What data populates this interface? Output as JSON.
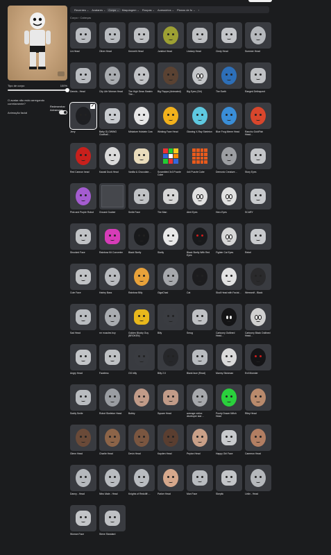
{
  "left_panel": {
    "body_type_label": "Tipo de corpo",
    "body_type_value": "100%",
    "body_type_level": 1.0,
    "warning_text": "O avatar não está carregando corretamente?",
    "redraw_label": "Redesenhar Advanced",
    "animation_label": "Animação facial",
    "animation_on": true
  },
  "tabs": [
    {
      "label": "Recentes"
    },
    {
      "label": "Avatares"
    },
    {
      "label": "Corpo",
      "selected": true
    },
    {
      "label": "Maquiagem"
    },
    {
      "label": "Roupas"
    },
    {
      "label": "Acessórios"
    },
    {
      "label": "Planos de fu"
    }
  ],
  "breadcrumb": "Corpo › Cabeças",
  "items": [
    {
      "label": "Lin Head",
      "style": "head",
      "color": "#b9bcc0"
    },
    {
      "label": "Oliver Head",
      "style": "head",
      "color": "#b9bcc0"
    },
    {
      "label": "Kenneth Head",
      "style": "head",
      "color": "#bfc1c4"
    },
    {
      "label": "Junkbot Head",
      "style": "round",
      "color": "#9da033"
    },
    {
      "label": "Lindsey Head",
      "style": "head",
      "color": "#bfc1c4"
    },
    {
      "label": "Cindy Head",
      "style": "head",
      "color": "#c3c5c8"
    },
    {
      "label": "Summer Head",
      "style": "round",
      "color": "#b5b8bc"
    },
    {
      "label": "Dennis - Head",
      "style": "head",
      "color": "#b9bcc0"
    },
    {
      "label": "City Life Woman Head",
      "style": "round",
      "color": "#a9acb0"
    },
    {
      "label": "The High Seas: Beatrix The…",
      "style": "round",
      "color": "#c0c2c5"
    },
    {
      "label": "Big Floppa (Animated)",
      "style": "round",
      "color": "#5a4232"
    },
    {
      "label": "Big Eyes (Girl)",
      "style": "bigeyes",
      "color": "#c3c5c8"
    },
    {
      "label": "The Earth",
      "style": "round",
      "color": "#2d6fb8"
    },
    {
      "label": "Ranged Delinquent",
      "style": "head",
      "color": "#bfc1c4"
    },
    {
      "label": "Jerry",
      "style": "round",
      "color": "#1e1f22",
      "selected": true
    },
    {
      "label": "Baby GLOWING Goofball…",
      "style": "head",
      "color": "#c9ccd0"
    },
    {
      "label": "Miniature Holstein Cow",
      "style": "round",
      "color": "#e6e6e6"
    },
    {
      "label": "Winking Face Head",
      "style": "round",
      "color": "#f2b11c"
    },
    {
      "label": "Glowing X-Ray Skeleton",
      "style": "round",
      "color": "#5ec8e0"
    },
    {
      "label": "Blue Frog Meme Head",
      "style": "round",
      "color": "#3a8ed8"
    },
    {
      "label": "Ranchu GoldFish Head…",
      "style": "round",
      "color": "#d8462c"
    },
    {
      "label": "Red Cannon head",
      "style": "round",
      "color": "#c8201c"
    },
    {
      "label": "Kawaii Duck Head",
      "style": "round",
      "color": "#dadada"
    },
    {
      "label": "Vanilla & Chocolate…",
      "style": "head",
      "color": "#e9dcbc"
    },
    {
      "label": "Scrambled 3x3 Puzzle Cube",
      "style": "cube3"
    },
    {
      "label": "4x4 Puzzle Cube",
      "style": "cube4"
    },
    {
      "label": "Demonic Creature…",
      "style": "round",
      "color": "#9c9ea2"
    },
    {
      "label": "Story Eyes",
      "style": "head",
      "color": "#c3c5c8"
    },
    {
      "label": "Pink and Purple Robot",
      "style": "round",
      "color": "#a45cd0"
    },
    {
      "label": "Ground Goober",
      "style": "ground"
    },
    {
      "label": "Smile Face",
      "style": "head",
      "color": "#c0c2c5"
    },
    {
      "label": "The Man",
      "style": "head",
      "color": "#d6d6d6"
    },
    {
      "label": "Alert Eyes",
      "style": "bigeyes",
      "color": "#e0e0e0"
    },
    {
      "label": "Hero Eyes",
      "style": "bigeyes",
      "color": "#e0e0e0"
    },
    {
      "label": "SCARY",
      "style": "head",
      "color": "#c8cacd"
    },
    {
      "label": "Shocked Face",
      "style": "head",
      "color": "#c0c2c5"
    },
    {
      "label": "Rainbow Kit Converter",
      "style": "head",
      "color": "#d63cb8"
    },
    {
      "label": "Black Skelly",
      "style": "round",
      "color": "#18191b"
    },
    {
      "label": "Skelly",
      "style": "round",
      "color": "#e8e8e8"
    },
    {
      "label": "Black Skelly With Red Eyes",
      "style": "redeyes",
      "color": "#18191b"
    },
    {
      "label": "Fighter Cat Eyes",
      "style": "bigeyes",
      "color": "#d6d6d6"
    },
    {
      "label": "Rebel",
      "style": "head",
      "color": "#c8cacd"
    },
    {
      "label": "Cute Face",
      "style": "head",
      "color": "#c0c2c5"
    },
    {
      "label": "Harley Bass",
      "style": "round",
      "color": "#b8babe"
    },
    {
      "label": "Rainbow Billy",
      "style": "round",
      "color": "#e8a23a"
    },
    {
      "label": "GigaChad",
      "style": "round",
      "color": "#a6a8ac"
    },
    {
      "label": "Cat",
      "style": "round",
      "color": "#1c1c1e"
    },
    {
      "label": "Skull Head with Facial…",
      "style": "round",
      "color": "#e2e2e2"
    },
    {
      "label": "Werewolf - Black",
      "style": "round",
      "color": "#2a2a2c"
    },
    {
      "label": "Sad Head",
      "style": "head",
      "color": "#b9bcc0"
    },
    {
      "label": "mr muscles boy",
      "style": "round",
      "color": "#a9acb0"
    },
    {
      "label": "Golden Blocky Guy (BROKEN)",
      "style": "head",
      "color": "#e8b81c"
    },
    {
      "label": "Billy",
      "style": "round",
      "color": "#3a3c41"
    },
    {
      "label": "Smug",
      "style": "head",
      "color": "#bfc1c4"
    },
    {
      "label": "Cartoony Outlined Head…",
      "style": "bigeyes",
      "color": "#141416"
    },
    {
      "label": "Cartoony Black Outlined Head…",
      "style": "bigeyes",
      "color": "#d0d0d0"
    },
    {
      "label": "Angry Head",
      "style": "head",
      "color": "#c3c5c8"
    },
    {
      "label": "Faceless",
      "style": "head",
      "color": "#bfc1c4"
    },
    {
      "label": "OG billy",
      "style": "round",
      "color": "#3a3c41"
    },
    {
      "label": "Billy 2.0",
      "style": "round",
      "color": "#26272a"
    },
    {
      "label": "Blank face (Read)",
      "style": "head",
      "color": "#b9bcc0"
    },
    {
      "label": "Marmy Stickman",
      "style": "round",
      "color": "#dadada"
    },
    {
      "label": "Evil Monster",
      "style": "redeyes",
      "color": "#141416"
    },
    {
      "label": "Swirly Smile",
      "style": "head",
      "color": "#b9bcc0"
    },
    {
      "label": "Robot Skeleton Head",
      "style": "round",
      "color": "#9a9da2"
    },
    {
      "label": "Bobby",
      "style": "round",
      "color": "#c19b88"
    },
    {
      "label": "Square Head",
      "style": "head",
      "color": "#c19b88"
    },
    {
      "label": "average roblox developer star…",
      "style": "round",
      "color": "#a6a8ac"
    },
    {
      "label": "Poorly Drawn Witch Head",
      "style": "round",
      "color": "#2ad13c"
    },
    {
      "label": "Riley Head",
      "style": "round",
      "color": "#b98a6c"
    },
    {
      "label": "Glenn Head",
      "style": "round",
      "color": "#6a4a38"
    },
    {
      "label": "Charlie Head",
      "style": "round",
      "color": "#8c6448"
    },
    {
      "label": "Devin Head",
      "style": "round",
      "color": "#7a5640"
    },
    {
      "label": "Kayden Head",
      "style": "round",
      "color": "#5a3e30"
    },
    {
      "label": "Peyton Head",
      "style": "round",
      "color": "#c9a088"
    },
    {
      "label": "Happy Girl Face",
      "style": "head",
      "color": "#c8cacd"
    },
    {
      "label": "Cameron Head",
      "style": "round",
      "color": "#b27e62"
    },
    {
      "label": "Danny - Head",
      "style": "round",
      "color": "#b5b8bc"
    },
    {
      "label": "Nitro Male - Head",
      "style": "round",
      "color": "#b9bcc0"
    },
    {
      "label": "Knights of Redcliff:…",
      "style": "round",
      "color": "#b9bcc0"
    },
    {
      "label": "Parker Head",
      "style": "round",
      "color": "#d6a88c"
    },
    {
      "label": "Man Face",
      "style": "head",
      "color": "#b9bcc0"
    },
    {
      "label": "Skeptic",
      "style": "head",
      "color": "#c3c5c8"
    },
    {
      "label": "Linlin - Head",
      "style": "round",
      "color": "#b5b8bc"
    },
    {
      "label": "Woman Face",
      "style": "head",
      "color": "#c3c5c8"
    },
    {
      "label": "Steve Standard",
      "style": "head",
      "color": "#bfc1c4"
    }
  ]
}
